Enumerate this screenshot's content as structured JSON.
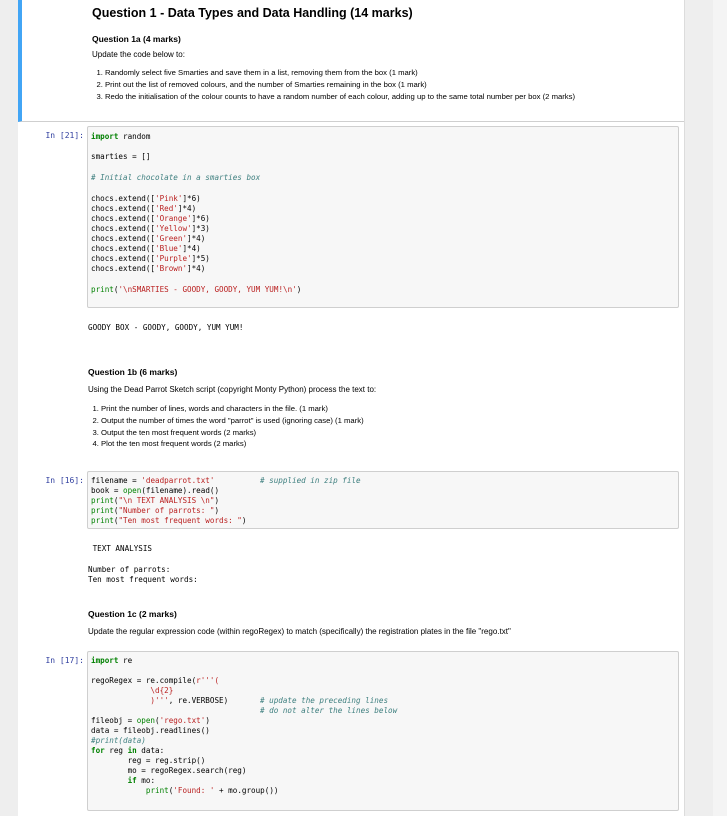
{
  "q1": {
    "title": "Question 1 - Data Types and Data Handling (14 marks)",
    "q1a_title": "Question 1a (4 marks)",
    "q1a_intro": "Update the code below to:",
    "q1a_items": [
      "Randomly select five Smarties and save them in a list, removing them from the box (1 mark)",
      "Print out the list of removed colours, and the number of Smarties remaining in the box (1 mark)",
      "Redo the initialisation of the colour counts to have a random number of each colour, adding up to the same total number per box (2 marks)"
    ]
  },
  "cell21": {
    "prompt": "In [21]:",
    "line1_kw": "import",
    "line1_rest": " random",
    "line2": "smarties = []",
    "comment": "# Initial chocolate in a smarties box",
    "extend_prefix": "chocs.extend([",
    "extends": [
      {
        "color": "'Pink'",
        "count": "]*6)"
      },
      {
        "color": "'Red'",
        "count": "]*4)"
      },
      {
        "color": "'Orange'",
        "count": "]*6)"
      },
      {
        "color": "'Yellow'",
        "count": "]*3)"
      },
      {
        "color": "'Green'",
        "count": "]*4)"
      },
      {
        "color": "'Blue'",
        "count": "]*4)"
      },
      {
        "color": "'Purple'",
        "count": "]*5)"
      },
      {
        "color": "'Brown'",
        "count": "]*4)"
      }
    ],
    "print_fn": "print",
    "print_open": "(",
    "print_str": "'\\nSMARTIES - GOODY, GOODY, YUM YUM!\\n'",
    "print_close": ")",
    "output": "GOODY BOX - GOODY, GOODY, YUM YUM!"
  },
  "q1b": {
    "title": "Question 1b (6 marks)",
    "intro": "Using the Dead Parrot Sketch script (copyright Monty Python) process the text to:",
    "items": [
      "Print the number of lines, words and characters in the file. (1 mark)",
      "Output the number of times the word \"parrot\" is used (ignoring case) (1 mark)",
      "Output the ten most frequent words (2 marks)",
      "Plot the ten most frequent words (2 marks)"
    ]
  },
  "cell16": {
    "prompt": "In [16]:",
    "l1_a": "filename = ",
    "l1_str": "'deadparrot.txt'",
    "l1_cm": "# supplied in zip file",
    "l2_a": "book = ",
    "l2_fn": "open",
    "l2_b": "(filename).read()",
    "l3_fn": "print",
    "l3_str": "\"\\n TEXT ANALYSIS \\n\"",
    "l4_fn": "print",
    "l4_str": "\"Number of parrots: \"",
    "l5_fn": "print",
    "l5_str": "\"Ten most frequent words: \"",
    "paren_open": "(",
    "paren_close": ")",
    "out1": " TEXT ANALYSIS",
    "out2": "Number of parrots:",
    "out3": "Ten most frequent words:"
  },
  "q1c": {
    "title": "Question 1c (2 marks)",
    "intro": "Update the regular expression code (within regoRegex) to match (specifically) the registration plates in the file \"rego.txt\""
  },
  "cell17": {
    "prompt": "In [17]:",
    "l1_kw": "import",
    "l1_rest": " re",
    "l2_a": "regoRegex = re.compile(",
    "l2_str": "r'''(",
    "l3_str": "             \\d{2}",
    "l4_str": "             )'''",
    "l4_rest": ", re.VERBOSE)",
    "l4_cm": "# update the preceding lines",
    "l5_cm": "# do not alter the lines below",
    "l6_a": "fileobj = ",
    "l6_fn": "open",
    "l6_str": "'rego.txt'",
    "l7": "data = fileobj.readlines()",
    "l8_cm": "#print(data)",
    "l9_kw1": "for",
    "l9_a": " reg ",
    "l9_kw2": "in",
    "l9_b": " data:",
    "l10": "        reg = reg.strip()",
    "l11": "        mo = regoRegex.search(reg)",
    "l12_kw": "if",
    "l12_rest": " mo:",
    "l13_fn": "print",
    "l13_str": "'Found: '",
    "l13_rest": " + mo.group())",
    "indent8": "        ",
    "indent12": "            ",
    "paren_open": "(",
    "paren_close": ")"
  }
}
